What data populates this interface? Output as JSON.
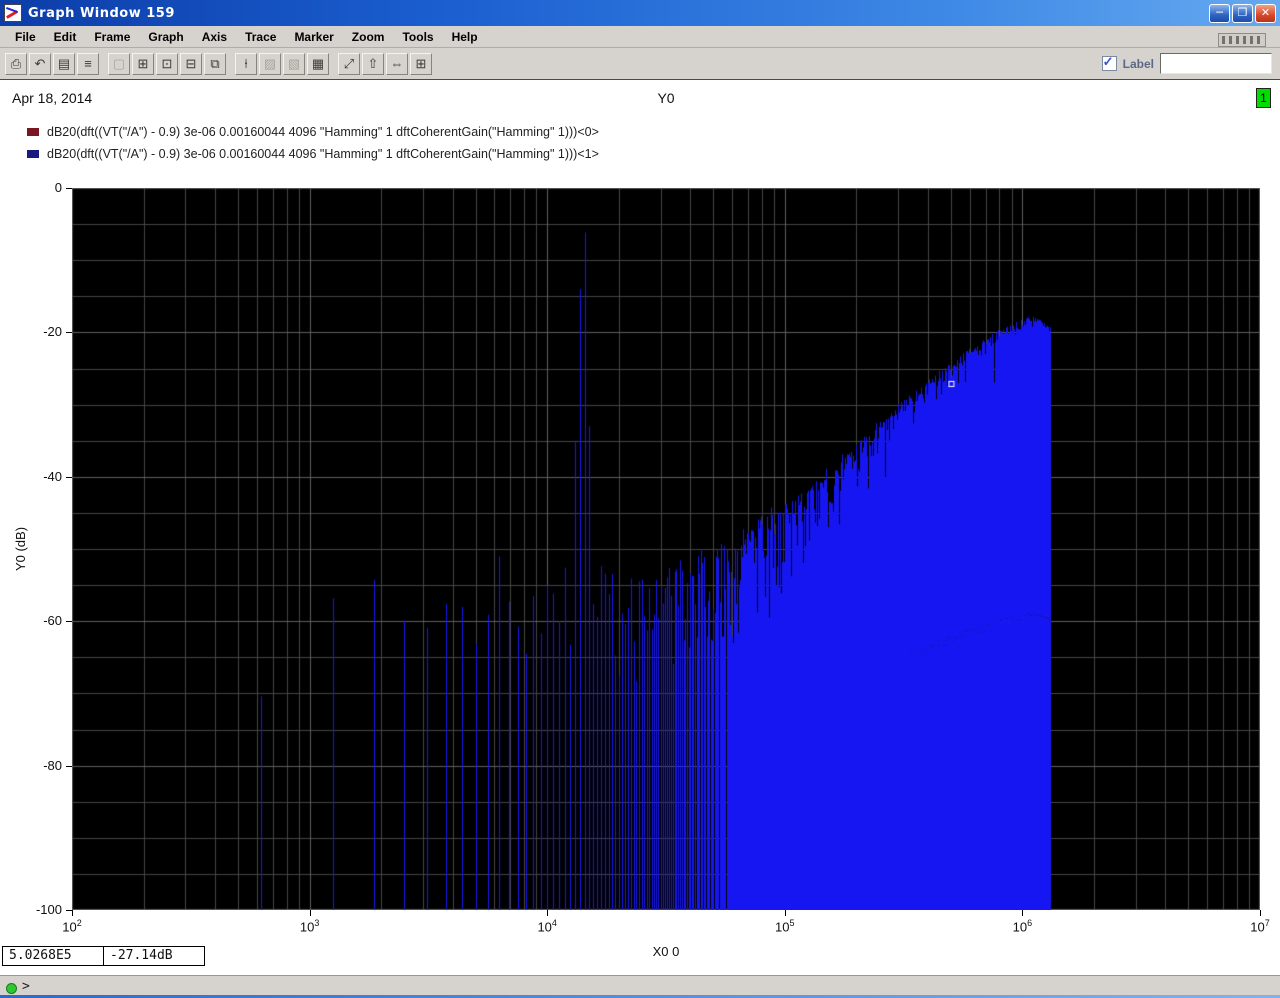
{
  "window": {
    "title": "Graph Window 159"
  },
  "titlebar": {
    "minimize": "─",
    "maximize": "❐",
    "close": "✕"
  },
  "menubar": {
    "items": [
      "File",
      "Edit",
      "Frame",
      "Graph",
      "Axis",
      "Trace",
      "Marker",
      "Zoom",
      "Tools",
      "Help"
    ]
  },
  "toolbar": {
    "icons": [
      {
        "name": "print-icon",
        "glyph": "⎙"
      },
      {
        "name": "undo-icon",
        "glyph": "↶"
      },
      {
        "name": "strip-chart-mode-icon",
        "glyph": "▤"
      },
      {
        "name": "composite-mode-icon",
        "glyph": "≡"
      },
      {
        "name": "snapshot-icon",
        "glyph": "▢",
        "disabled": true,
        "sep_before": true
      },
      {
        "name": "new-subwindow-icon",
        "glyph": "⊞"
      },
      {
        "name": "add-graph-icon",
        "glyph": "⊡"
      },
      {
        "name": "delete-subwindow-icon",
        "glyph": "⊟"
      },
      {
        "name": "copy-window-icon",
        "glyph": "⧉"
      },
      {
        "name": "marker-icon",
        "glyph": "⍿",
        "sep_before": true
      },
      {
        "name": "pattern-a-icon",
        "glyph": "▨",
        "disabled": true
      },
      {
        "name": "pattern-b-icon",
        "glyph": "▧",
        "disabled": true
      },
      {
        "name": "table-icon",
        "glyph": "▦"
      },
      {
        "name": "zoom-fit-icon",
        "glyph": "⤢",
        "sep_before": true
      },
      {
        "name": "pan-up-icon",
        "glyph": "⇧"
      },
      {
        "name": "pan-horizontal-icon",
        "glyph": "⇔"
      },
      {
        "name": "zoom-box-icon",
        "glyph": "⊞"
      }
    ],
    "label_text": "Label",
    "label_input_value": ""
  },
  "header": {
    "date": "Apr 18, 2014",
    "title": "Y0",
    "badge": "1"
  },
  "legend": [
    {
      "color": "#7a1622",
      "text": "dB20(dft((VT(\"/A\") - 0.9) 3e-06 0.00160044 4096 \"Hamming\" 1 dftCoherentGain(\"Hamming\" 1)))<0>"
    },
    {
      "color": "#1a1a7e",
      "text": "dB20(dft((VT(\"/A\") - 0.9) 3e-06 0.00160044 4096 \"Hamming\" 1 dftCoherentGain(\"Hamming\" 1)))<1>"
    }
  ],
  "readouts": {
    "x": "5.0268E5",
    "y": "-27.14dB"
  },
  "statusbar": {
    "prompt": ">"
  },
  "chart_data": {
    "type": "line",
    "title": "Y0",
    "xlabel": "X0 0",
    "ylabel": "Y0 (dB)",
    "x_scale": "log",
    "x_range": [
      100,
      10000000
    ],
    "y_range": [
      -100,
      0
    ],
    "x_ticks": [
      {
        "base": "10",
        "exp": "2"
      },
      {
        "base": "10",
        "exp": "3"
      },
      {
        "base": "10",
        "exp": "4"
      },
      {
        "base": "10",
        "exp": "5"
      },
      {
        "base": "10",
        "exp": "6"
      },
      {
        "base": "10",
        "exp": "7"
      }
    ],
    "y_ticks": [
      "0",
      "-20",
      "-40",
      "-60",
      "-80",
      "-100"
    ],
    "grid": {
      "minor_color": "#454545",
      "major_color": "#5f5f5f",
      "y_minor_step_db": 5,
      "y_major_step_db": 20
    },
    "background": "#000000",
    "trace_color": "#1616f2",
    "series": [
      {
        "name": "<0>"
      },
      {
        "name": "<1>"
      }
    ],
    "spectrum": {
      "bin_hz": 625,
      "first_bin_hz": 625,
      "last_hz": 1310000,
      "signal_bins": [
        [
          13125,
          -35
        ],
        [
          13750,
          -14
        ],
        [
          14375,
          -6.2
        ],
        [
          15000,
          -33
        ]
      ],
      "envelope_log10f_db": [
        [
          2.796,
          -66
        ],
        [
          3.1,
          -57
        ],
        [
          3.28,
          -55
        ],
        [
          3.4,
          -60
        ],
        [
          3.5,
          -62
        ],
        [
          3.57,
          -58
        ],
        [
          3.7,
          -57
        ],
        [
          3.8,
          -52
        ],
        [
          3.9,
          -55
        ],
        [
          4.0,
          -56
        ],
        [
          4.1,
          -54
        ],
        [
          4.2,
          -53
        ],
        [
          4.3,
          -55
        ],
        [
          4.4,
          -56
        ],
        [
          4.5,
          -54
        ],
        [
          4.6,
          -52
        ],
        [
          4.7,
          -51
        ],
        [
          4.8,
          -50
        ],
        [
          4.9,
          -47
        ],
        [
          5.0,
          -45
        ],
        [
          5.1,
          -43
        ],
        [
          5.2,
          -40
        ],
        [
          5.3,
          -37
        ],
        [
          5.4,
          -34
        ],
        [
          5.5,
          -31
        ],
        [
          5.6,
          -28.5
        ],
        [
          5.7,
          -26
        ],
        [
          5.8,
          -23.5
        ],
        [
          5.9,
          -21.5
        ],
        [
          6.0,
          -20
        ],
        [
          6.06,
          -19.5
        ],
        [
          6.115,
          -21
        ]
      ],
      "jitter_db": 14,
      "seed": 20140418
    },
    "marker": {
      "x": 502680,
      "y_db": -27.14
    }
  }
}
